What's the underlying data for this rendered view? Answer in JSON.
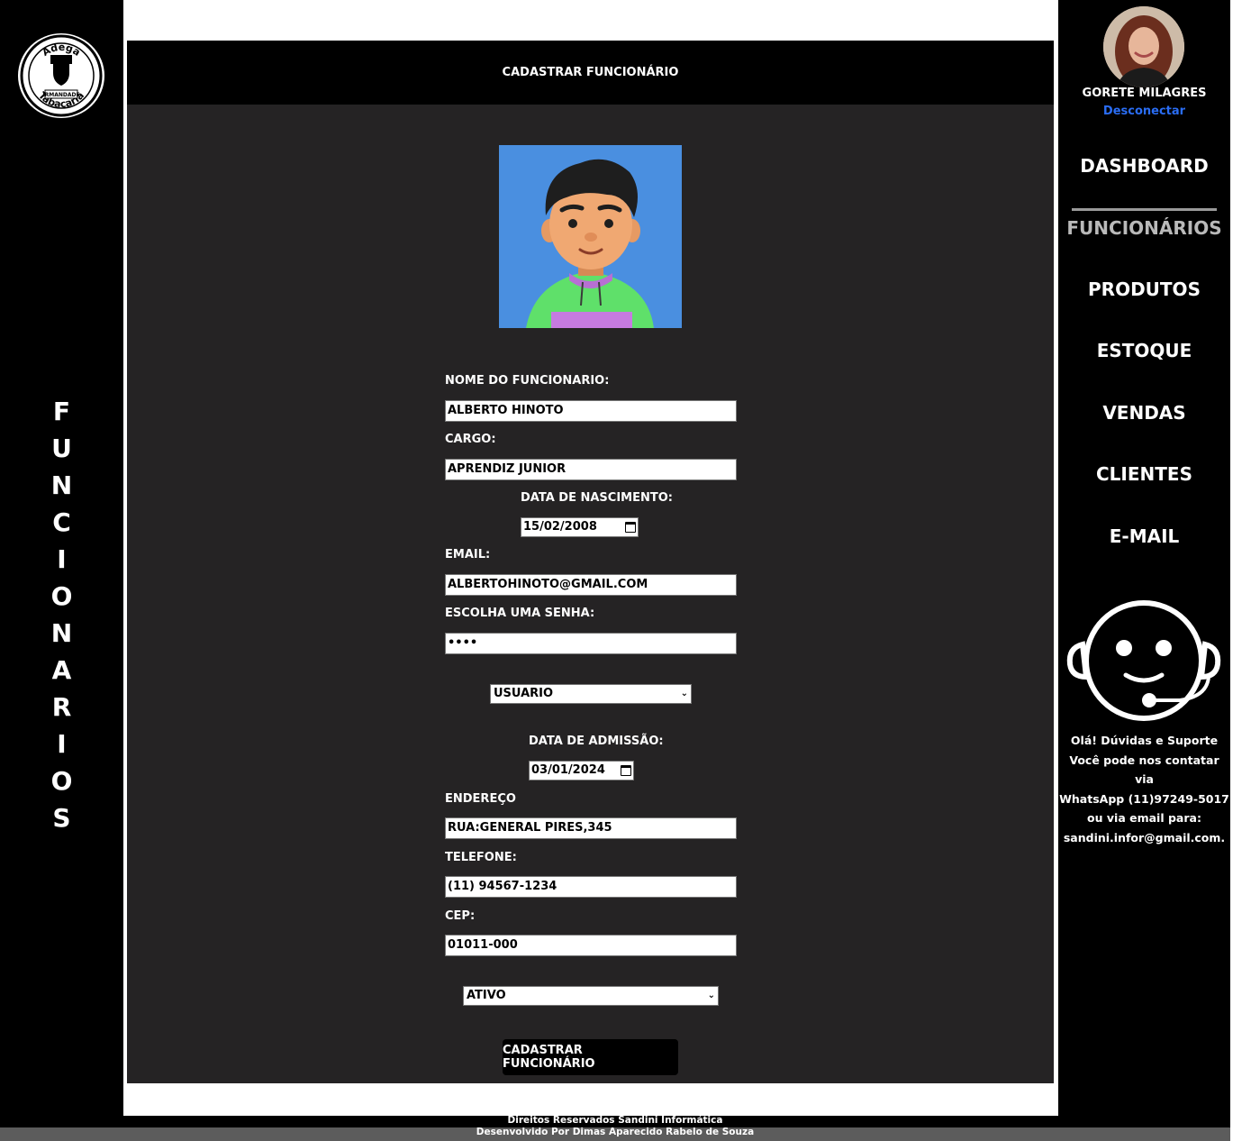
{
  "logo": {
    "top_text": "Adega",
    "middle_text": "IRMANDADE",
    "bottom_text": "Tabacaria",
    "icon": "fist-icon"
  },
  "section_title_vertical": [
    "F",
    "U",
    "N",
    "C",
    "I",
    "O",
    "N",
    "A",
    "R",
    "I",
    "O",
    "S"
  ],
  "header": {
    "title": "CADASTRAR FUNCIONÁRIO"
  },
  "form": {
    "avatar_icon": "employee-avatar",
    "name_label": "NOME DO FUNCIONARIO:",
    "name_value": "ALBERTO HINOTO",
    "role_label": "CARGO:",
    "role_value": "APRENDIZ JUNIOR",
    "birth_label": "DATA DE NASCIMENTO:",
    "birth_value": "15/02/2008",
    "email_label": "EMAIL:",
    "email_value": "ALBERTOHINOTO@GMAIL.COM",
    "password_label": "ESCOLHA UMA SENHA:",
    "password_value": "••••",
    "access_select": "USUARIO",
    "admission_label": "DATA DE ADMISSÃO:",
    "admission_value": "03/01/2024",
    "address_label": "ENDEREÇO",
    "address_value": "RUA:GENERAL PIRES,345",
    "phone_label": "TELEFONE:",
    "phone_value": "(11) 94567-1234",
    "cep_label": "CEP:",
    "cep_value": "01011-000",
    "status_select": "ATIVO",
    "submit_label": "CADASTRAR FUNCIONÁRIO"
  },
  "user": {
    "name": "GORETE MILAGRES",
    "logout": "Desconectar"
  },
  "nav": {
    "dashboard": "DASHBOARD",
    "employees": "FUNCIONÁRIOS",
    "products": "PRODUTOS",
    "stock": "ESTOQUE",
    "sales": "VENDAS",
    "clients": "CLIENTES",
    "email": "E-MAIL",
    "active": "FUNCIONÁRIOS"
  },
  "support": {
    "icon": "support-headset-icon",
    "line1": "Olá! Dúvidas e Suporte",
    "line2": "Você pode nos contatar via",
    "line3": "WhatsApp (11)97249-5017",
    "line4": "ou via email para:",
    "line5": "sandini.infor@gmail.com."
  },
  "footer": {
    "line1": "Direitos Reservados Sandini Informática",
    "line2": "Desenvolvido Por Dimas Aparecido Rabelo de Souza"
  },
  "colors": {
    "sidebar_bg": "#000000",
    "panel_bg": "#252324",
    "link_blue": "#2a6df4",
    "avatar_bg": "#4a8fe0",
    "active_nav": "#b9b9b9"
  }
}
